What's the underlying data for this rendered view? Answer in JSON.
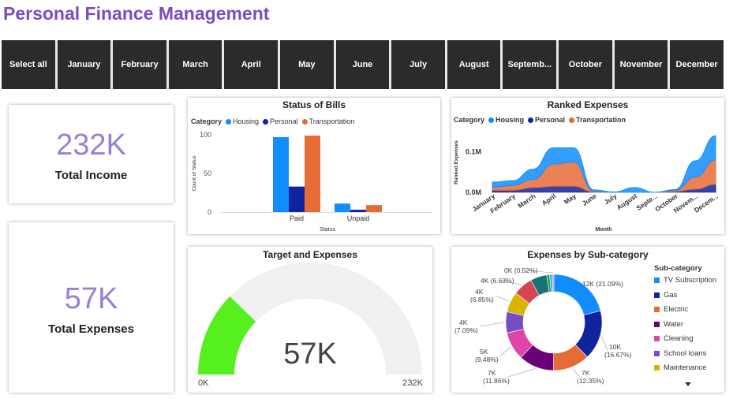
{
  "page_title": "Personal Finance Management",
  "slicer": [
    "Select all",
    "January",
    "February",
    "March",
    "April",
    "May",
    "June",
    "July",
    "August",
    "Septemb...",
    "October",
    "November",
    "December"
  ],
  "kpis": {
    "income": {
      "value": "232K",
      "label": "Total Income"
    },
    "expenses": {
      "value": "57K",
      "label": "Total Expenses"
    }
  },
  "colors": {
    "housing": "#118DFF",
    "personal": "#12239E",
    "transportation": "#E66C37"
  },
  "bills": {
    "title": "Status of Bills",
    "legend_title": "Category",
    "legend": [
      "Housing",
      "Personal",
      "Transportation"
    ],
    "chart_data": {
      "type": "bar",
      "categories": [
        "Paid",
        "Unpaid"
      ],
      "series": [
        {
          "name": "Housing",
          "values": [
            97,
            11
          ]
        },
        {
          "name": "Personal",
          "values": [
            33,
            3
          ]
        },
        {
          "name": "Transportation",
          "values": [
            99,
            9
          ]
        }
      ],
      "xlabel": "Status",
      "ylabel": "Count of Status",
      "yticks": [
        "100",
        "50",
        "0"
      ],
      "ylim": [
        0,
        100
      ]
    }
  },
  "ranked": {
    "title": "Ranked Expenses",
    "legend_title": "Category",
    "legend": [
      "Housing",
      "Personal",
      "Transportation"
    ],
    "chart_data": {
      "type": "area",
      "categories": [
        "January",
        "February",
        "March",
        "April",
        "May",
        "June",
        "July",
        "August",
        "Septe...",
        "October",
        "Novem...",
        "Decem..."
      ],
      "series": [
        {
          "name": "Personal",
          "values": [
            0.005,
            0.005,
            0.012,
            0.015,
            0.015,
            0.001,
            0.0,
            0.0,
            0.0,
            0.002,
            0.008,
            0.02
          ]
        },
        {
          "name": "Transportation",
          "values": [
            0.008,
            0.012,
            0.02,
            0.055,
            0.06,
            0.002,
            0.0,
            0.0,
            0.0,
            0.003,
            0.03,
            0.06
          ]
        },
        {
          "name": "Housing",
          "values": [
            0.012,
            0.012,
            0.025,
            0.04,
            0.035,
            0.003,
            0.001,
            0.012,
            0.0,
            0.002,
            0.04,
            0.06
          ]
        }
      ],
      "xlabel": "Month",
      "ylabel": "Ranked Expenses",
      "yticks": [
        "0.1M",
        "0.0M"
      ],
      "ylim": [
        0,
        0.15
      ]
    }
  },
  "gauge": {
    "title": "Target and Expenses",
    "value_label": "57K",
    "min_label": "0K",
    "max_label": "232K",
    "chart_data": {
      "type": "gauge",
      "value": 57,
      "min": 0,
      "max": 232
    }
  },
  "subcat": {
    "title": "Expenses by Sub-category",
    "legend_title": "Sub-category",
    "chart_data": {
      "type": "pie",
      "slices": [
        {
          "name": "TV Subscription",
          "label": "12K (21.09%)",
          "pct": 21.09,
          "color": "#118DFF"
        },
        {
          "name": "Gas",
          "label": "10K (16.67%)",
          "pct": 16.67,
          "color": "#12239E"
        },
        {
          "name": "Electric",
          "label": "7K (12.35%)",
          "pct": 12.35,
          "color": "#E66C37"
        },
        {
          "name": "Water",
          "label": "7K (11.86%)",
          "pct": 11.86,
          "color": "#6B007B"
        },
        {
          "name": "Cleaning",
          "label": "5K (9.48%)",
          "pct": 9.48,
          "color": "#E044A7"
        },
        {
          "name": "School loans",
          "label": "4K (7.09%)",
          "pct": 7.09,
          "color": "#744EC2"
        },
        {
          "name": "Maintenance",
          "label": "4K (6.85%)",
          "pct": 6.85,
          "color": "#D9B300"
        },
        {
          "name": "",
          "label": "4K (6.63%)",
          "pct": 6.63,
          "color": "#D64550"
        },
        {
          "name": "",
          "label": "",
          "pct": 5.5,
          "color": "#197278"
        },
        {
          "name": "",
          "label": "",
          "pct": 1.0,
          "color": "#1AAB40"
        },
        {
          "name": "",
          "label": "",
          "pct": 0.9,
          "color": "#15C6F4"
        },
        {
          "name": "",
          "label": "0K (0.52%)",
          "pct": 0.52,
          "color": "#FF69B4"
        }
      ]
    }
  }
}
